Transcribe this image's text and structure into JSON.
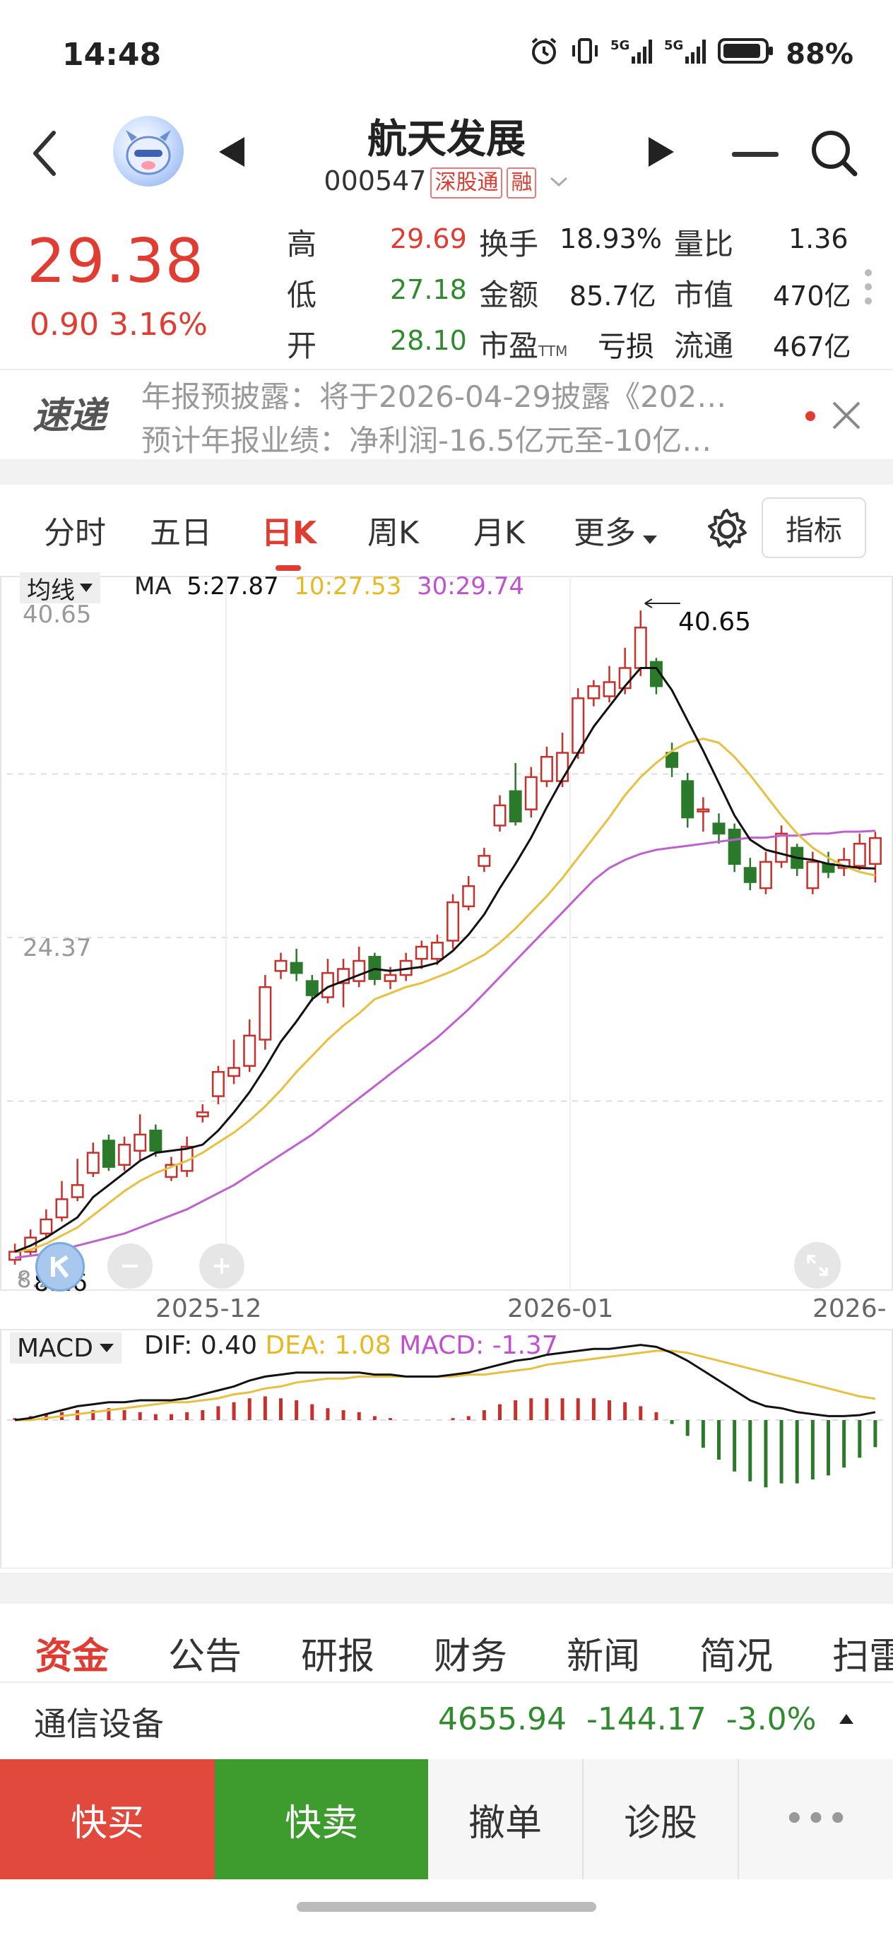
{
  "status_bar": {
    "time": "14:48",
    "battery": "88%"
  },
  "stock": {
    "name": "航天发展",
    "code": "000547",
    "tag1": "深股通",
    "tag2": "融",
    "price": "29.38",
    "change": "0.90",
    "change_pct": "3.16%"
  },
  "metrics": {
    "high_label": "高",
    "high": "29.69",
    "low_label": "低",
    "low": "27.18",
    "open_label": "开",
    "open": "28.10",
    "turnover_label": "换手",
    "turnover": "18.93%",
    "amount_label": "金额",
    "amount": "85.7亿",
    "pe_label": "市盈",
    "pe_sub": "TTM",
    "pe": "亏损",
    "vol_ratio_label": "量比",
    "vol_ratio": "1.36",
    "mktcap_label": "市值",
    "mktcap": "470亿",
    "float_label": "流通",
    "float": "467亿"
  },
  "notice": {
    "badge": "速递",
    "line1": "年报预披露：将于2026-04-29披露《202…",
    "line2": "预计年报业绩：净利润-16.5亿元至-10亿…"
  },
  "chart_tabs": [
    "分时",
    "五日",
    "日K",
    "周K",
    "月K",
    "更多"
  ],
  "indicator_button": "指标",
  "ma_legend": {
    "dropdown": "均线",
    "ma": "MA",
    "ma5": "5:27.87",
    "ma10": "10:27.53",
    "ma30": "30:29.74"
  },
  "price_axis": {
    "top": "40.65",
    "mid": "24.37",
    "bottom": "8.26"
  },
  "peak_label": "40.65",
  "low_label": "8.26",
  "date_axis": [
    "2025-12",
    "2026-01",
    "2026-"
  ],
  "macd_legend": {
    "dropdown": "MACD",
    "dif": "DIF: 0.40",
    "dea": "DEA: 1.08",
    "macd": "MACD: -1.37"
  },
  "colors": {
    "up": "#c8302c",
    "down": "#2b7a2b",
    "ma5": "#111111",
    "ma10": "#e8c040",
    "ma30": "#c060d0"
  },
  "chart_data": {
    "type": "candlestick",
    "ylim": [
      8.26,
      40.65
    ],
    "candles": [
      {
        "o": 8.5,
        "c": 8.9,
        "h": 9.3,
        "l": 8.26
      },
      {
        "o": 8.9,
        "c": 9.6,
        "h": 10.0,
        "l": 8.7
      },
      {
        "o": 9.8,
        "c": 10.5,
        "h": 11.0,
        "l": 9.6
      },
      {
        "o": 10.6,
        "c": 11.5,
        "h": 12.4,
        "l": 10.4
      },
      {
        "o": 11.6,
        "c": 12.2,
        "h": 13.5,
        "l": 11.4
      },
      {
        "o": 12.8,
        "c": 13.8,
        "h": 14.3,
        "l": 12.6
      },
      {
        "o": 14.4,
        "c": 13.1,
        "h": 14.7,
        "l": 12.9
      },
      {
        "o": 13.2,
        "c": 14.2,
        "h": 14.6,
        "l": 12.9
      },
      {
        "o": 13.9,
        "c": 14.7,
        "h": 15.7,
        "l": 13.4
      },
      {
        "o": 14.9,
        "c": 13.9,
        "h": 15.2,
        "l": 13.6
      },
      {
        "o": 12.6,
        "c": 13.2,
        "h": 13.6,
        "l": 12.4
      },
      {
        "o": 12.9,
        "c": 14.1,
        "h": 14.6,
        "l": 12.6
      },
      {
        "o": 15.6,
        "c": 15.8,
        "h": 16.2,
        "l": 15.3
      },
      {
        "o": 16.6,
        "c": 17.8,
        "h": 18.1,
        "l": 16.2
      },
      {
        "o": 17.6,
        "c": 18.0,
        "h": 19.4,
        "l": 17.2
      },
      {
        "o": 18.1,
        "c": 19.6,
        "h": 20.4,
        "l": 17.8
      },
      {
        "o": 19.4,
        "c": 22.0,
        "h": 22.6,
        "l": 18.9
      },
      {
        "o": 22.8,
        "c": 23.3,
        "h": 23.7,
        "l": 22.4
      },
      {
        "o": 23.2,
        "c": 22.7,
        "h": 23.9,
        "l": 22.3
      },
      {
        "o": 22.3,
        "c": 21.6,
        "h": 22.6,
        "l": 21.3
      },
      {
        "o": 21.5,
        "c": 22.7,
        "h": 23.4,
        "l": 21.2
      },
      {
        "o": 22.2,
        "c": 22.9,
        "h": 23.4,
        "l": 21.0
      },
      {
        "o": 22.3,
        "c": 23.3,
        "h": 24.0,
        "l": 22.0
      },
      {
        "o": 23.5,
        "c": 22.4,
        "h": 23.7,
        "l": 22.1
      },
      {
        "o": 22.3,
        "c": 22.6,
        "h": 23.0,
        "l": 21.9
      },
      {
        "o": 22.6,
        "c": 23.3,
        "h": 23.7,
        "l": 22.3
      },
      {
        "o": 23.4,
        "c": 24.0,
        "h": 24.3,
        "l": 22.9
      },
      {
        "o": 23.4,
        "c": 24.2,
        "h": 24.6,
        "l": 23.1
      },
      {
        "o": 24.3,
        "c": 26.2,
        "h": 26.6,
        "l": 23.9
      },
      {
        "o": 26.0,
        "c": 27.0,
        "h": 27.5,
        "l": 25.8
      },
      {
        "o": 28.0,
        "c": 28.5,
        "h": 28.9,
        "l": 27.7
      },
      {
        "o": 30.0,
        "c": 31.0,
        "h": 31.5,
        "l": 29.7
      },
      {
        "o": 31.7,
        "c": 30.2,
        "h": 33.1,
        "l": 30.0
      },
      {
        "o": 30.8,
        "c": 32.4,
        "h": 32.9,
        "l": 30.4
      },
      {
        "o": 32.2,
        "c": 33.4,
        "h": 33.9,
        "l": 31.9
      },
      {
        "o": 32.2,
        "c": 33.6,
        "h": 34.6,
        "l": 31.9
      },
      {
        "o": 33.6,
        "c": 36.3,
        "h": 36.8,
        "l": 33.3
      },
      {
        "o": 36.3,
        "c": 36.9,
        "h": 37.2,
        "l": 35.9
      },
      {
        "o": 36.4,
        "c": 37.1,
        "h": 37.9,
        "l": 36.1
      },
      {
        "o": 36.8,
        "c": 37.8,
        "h": 38.8,
        "l": 36.5
      },
      {
        "o": 37.8,
        "c": 39.8,
        "h": 40.65,
        "l": 37.4
      },
      {
        "o": 38.1,
        "c": 36.9,
        "h": 38.3,
        "l": 36.5
      },
      {
        "o": 33.6,
        "c": 32.9,
        "h": 34.1,
        "l": 32.4
      },
      {
        "o": 32.2,
        "c": 30.4,
        "h": 32.6,
        "l": 29.9
      },
      {
        "o": 30.7,
        "c": 30.8,
        "h": 31.4,
        "l": 29.7
      },
      {
        "o": 30.1,
        "c": 29.6,
        "h": 30.6,
        "l": 29.1
      },
      {
        "o": 29.8,
        "c": 28.1,
        "h": 30.1,
        "l": 27.7
      },
      {
        "o": 27.9,
        "c": 27.2,
        "h": 28.4,
        "l": 26.8
      },
      {
        "o": 26.9,
        "c": 28.2,
        "h": 28.7,
        "l": 26.6
      },
      {
        "o": 28.2,
        "c": 29.6,
        "h": 30.0,
        "l": 27.9
      },
      {
        "o": 28.9,
        "c": 27.9,
        "h": 29.1,
        "l": 27.5
      },
      {
        "o": 26.9,
        "c": 28.2,
        "h": 28.7,
        "l": 26.6
      },
      {
        "o": 28.1,
        "c": 27.7,
        "h": 28.7,
        "l": 27.4
      },
      {
        "o": 27.9,
        "c": 28.3,
        "h": 28.9,
        "l": 27.5
      },
      {
        "o": 28.0,
        "c": 29.1,
        "h": 29.6,
        "l": 27.8
      },
      {
        "o": 28.1,
        "c": 29.38,
        "h": 29.69,
        "l": 27.18
      }
    ],
    "ma5": [
      8.9,
      9.2,
      9.6,
      10.1,
      10.6,
      11.6,
      12.2,
      12.8,
      13.4,
      13.8,
      13.9,
      14.0,
      14.2,
      14.9,
      15.8,
      16.8,
      18.0,
      19.3,
      20.3,
      21.4,
      22.0,
      22.3,
      22.6,
      22.9,
      22.8,
      22.9,
      23.0,
      23.2,
      23.8,
      24.6,
      25.6,
      26.9,
      28.1,
      29.4,
      30.9,
      32.3,
      33.6,
      34.9,
      35.9,
      36.9,
      37.8,
      37.8,
      36.7,
      35.2,
      33.7,
      32.1,
      30.5,
      29.3,
      28.8,
      28.6,
      28.4,
      28.3,
      28.1,
      28.0,
      27.9,
      27.87
    ],
    "ma10": [
      8.9,
      9.0,
      9.3,
      9.7,
      10.1,
      10.7,
      11.3,
      11.9,
      12.4,
      12.8,
      13.1,
      13.4,
      13.8,
      14.3,
      14.8,
      15.4,
      16.1,
      16.9,
      17.8,
      18.6,
      19.4,
      20.1,
      20.7,
      21.4,
      21.7,
      22.0,
      22.2,
      22.5,
      22.8,
      23.2,
      23.6,
      24.2,
      24.9,
      25.7,
      26.5,
      27.4,
      28.4,
      29.4,
      30.4,
      31.5,
      32.4,
      33.1,
      33.7,
      34.1,
      34.3,
      34.1,
      33.4,
      32.5,
      31.5,
      30.5,
      29.6,
      28.9,
      28.4,
      28.0,
      27.7,
      27.53
    ],
    "ma30": [
      8.6,
      8.7,
      8.8,
      9.0,
      9.2,
      9.4,
      9.6,
      9.8,
      10.1,
      10.4,
      10.7,
      11.0,
      11.4,
      11.8,
      12.2,
      12.7,
      13.2,
      13.7,
      14.2,
      14.7,
      15.3,
      15.9,
      16.5,
      17.1,
      17.7,
      18.3,
      18.9,
      19.5,
      20.2,
      20.9,
      21.7,
      22.5,
      23.3,
      24.1,
      24.9,
      25.7,
      26.5,
      27.3,
      27.9,
      28.3,
      28.6,
      28.8,
      28.9,
      29.0,
      29.1,
      29.2,
      29.3,
      29.4,
      29.4,
      29.5,
      29.5,
      29.6,
      29.6,
      29.7,
      29.7,
      29.74
    ],
    "macd": {
      "dif": [
        0.0,
        0.1,
        0.3,
        0.5,
        0.7,
        0.8,
        0.9,
        0.9,
        1.0,
        1.0,
        1.0,
        1.1,
        1.3,
        1.5,
        1.7,
        2.0,
        2.2,
        2.3,
        2.4,
        2.4,
        2.4,
        2.4,
        2.4,
        2.3,
        2.3,
        2.2,
        2.2,
        2.2,
        2.3,
        2.4,
        2.6,
        2.8,
        3.0,
        3.1,
        3.3,
        3.4,
        3.5,
        3.6,
        3.6,
        3.7,
        3.8,
        3.7,
        3.4,
        3.0,
        2.5,
        2.0,
        1.5,
        1.0,
        0.7,
        0.6,
        0.4,
        0.3,
        0.2,
        0.2,
        0.25,
        0.4
      ],
      "dea": [
        0.0,
        0.0,
        0.1,
        0.2,
        0.3,
        0.4,
        0.5,
        0.6,
        0.7,
        0.8,
        0.9,
        0.9,
        1.0,
        1.1,
        1.3,
        1.4,
        1.6,
        1.7,
        1.9,
        2.0,
        2.1,
        2.1,
        2.2,
        2.2,
        2.2,
        2.2,
        2.2,
        2.2,
        2.2,
        2.3,
        2.3,
        2.4,
        2.5,
        2.6,
        2.8,
        2.9,
        3.0,
        3.1,
        3.2,
        3.3,
        3.4,
        3.5,
        3.5,
        3.4,
        3.2,
        3.0,
        2.8,
        2.6,
        2.4,
        2.2,
        2.0,
        1.8,
        1.6,
        1.4,
        1.2,
        1.08
      ],
      "hist": [
        0.1,
        0.2,
        0.3,
        0.4,
        0.5,
        0.5,
        0.6,
        0.5,
        0.4,
        0.3,
        0.3,
        0.4,
        0.5,
        0.7,
        0.9,
        1.1,
        1.2,
        1.1,
        1.0,
        0.8,
        0.6,
        0.5,
        0.4,
        0.2,
        0.1,
        0.0,
        0.0,
        0.0,
        0.1,
        0.2,
        0.5,
        0.8,
        1.0,
        1.1,
        1.1,
        1.1,
        1.1,
        1.1,
        1.0,
        0.9,
        0.7,
        0.4,
        -0.2,
        -0.8,
        -1.4,
        -2.0,
        -2.6,
        -3.1,
        -3.4,
        -3.2,
        -3.2,
        -3.0,
        -2.8,
        -2.4,
        -1.9,
        -1.37
      ]
    }
  },
  "bottom_tabs": [
    "资金",
    "公告",
    "研报",
    "财务",
    "新闻",
    "简况",
    "扫雷"
  ],
  "industry": {
    "name": "通信设备",
    "value": "4655.94",
    "change": "-144.17",
    "pct": "-3.0%"
  },
  "actions": {
    "buy": "快买",
    "sell": "快卖",
    "cancel": "撤单",
    "diagnose": "诊股",
    "more": "•••"
  }
}
